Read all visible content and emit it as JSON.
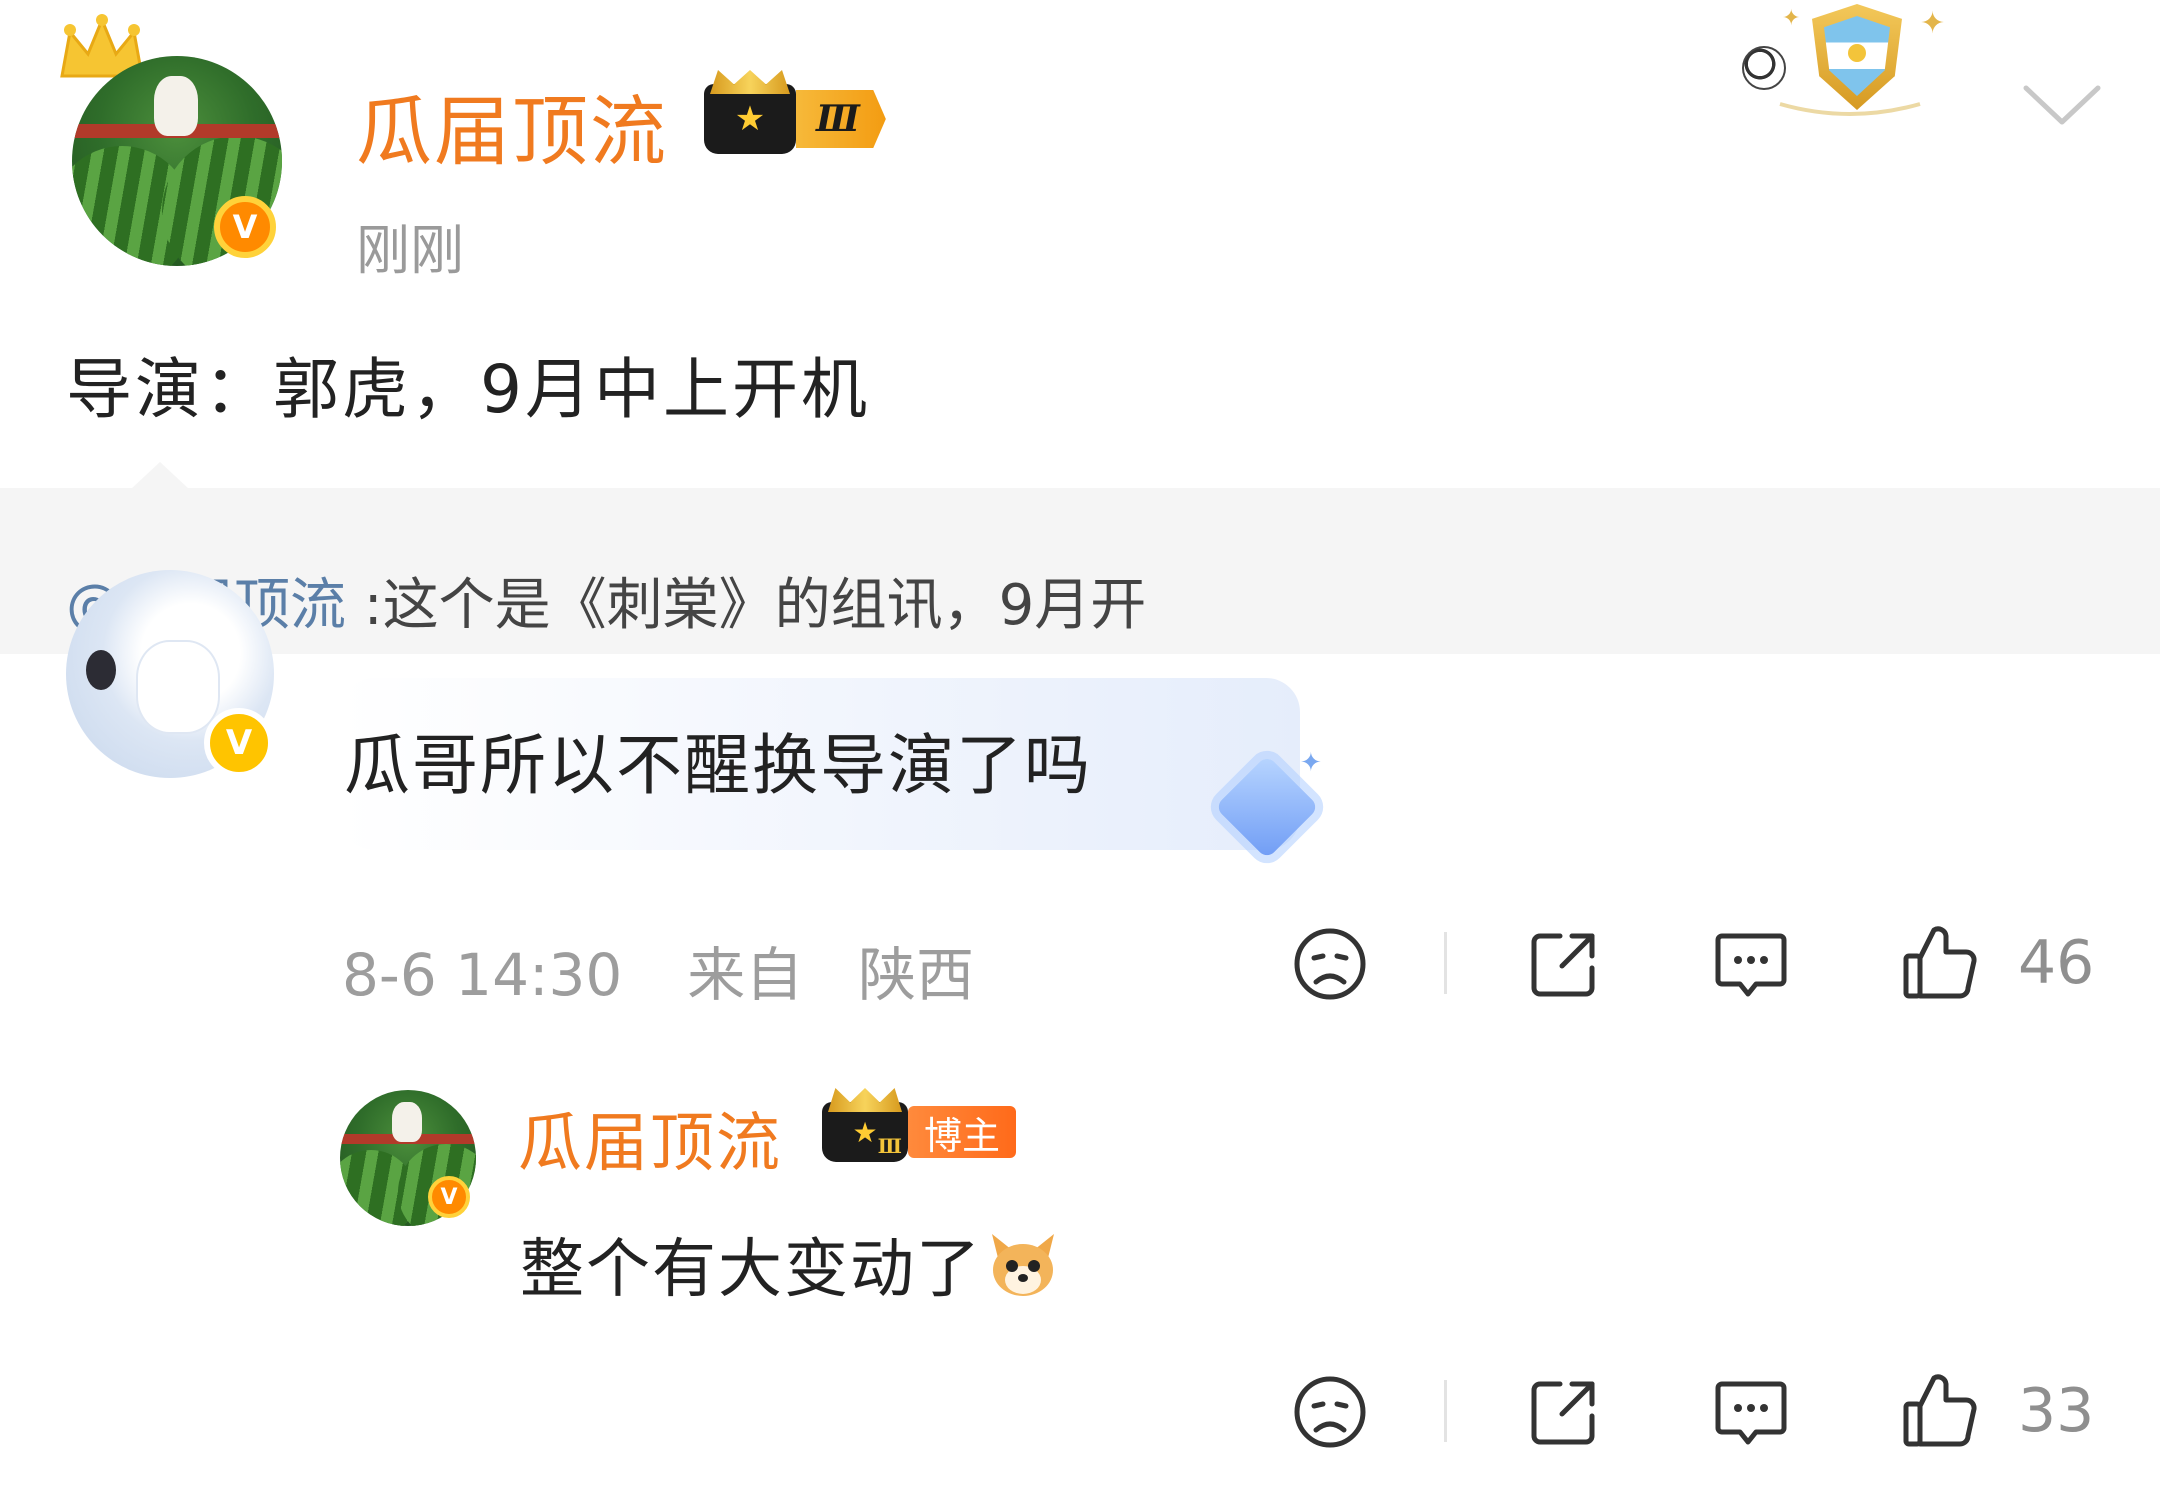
{
  "post": {
    "username": "瓜届顶流",
    "level_roman": "Ⅲ",
    "time": "刚刚",
    "text": "导演：郭虎，9月中上开机"
  },
  "quote": {
    "mention": "@瓜届顶流",
    "text": " :这个是《刺棠》的组讯，9月开"
  },
  "comment": {
    "text": "瓜哥所以不醒换导演了吗",
    "date": "8-6 14:30",
    "from_label": "来自",
    "location": "陕西",
    "likes": "46"
  },
  "reply": {
    "username": "瓜届顶流",
    "level_roman": "Ⅲ",
    "role_badge": "博主",
    "text": "整个有大变动了",
    "likes": "33"
  },
  "icons": {
    "verified": "V",
    "dislike": "sad-face-icon",
    "share": "share-icon",
    "reply": "comment-icon",
    "like": "thumbs-up-icon"
  },
  "colors": {
    "username": "#f07a1f",
    "mention": "#5b7fa8",
    "meta": "#9d9d9d",
    "verified_badge": "#ff8a00"
  }
}
